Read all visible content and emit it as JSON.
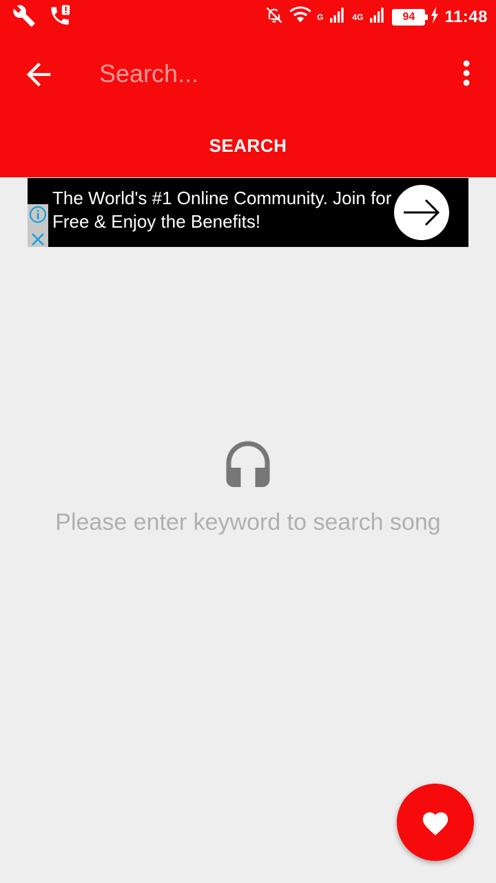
{
  "status_bar": {
    "battery": "94",
    "network_1": "G",
    "network_2": "4G",
    "time": "11:48"
  },
  "toolbar": {
    "search_placeholder": "Search..."
  },
  "tab": {
    "label": "SEARCH"
  },
  "ad": {
    "text": "The World's #1 Online Community. Join for Free & Enjoy the Benefits!"
  },
  "empty_state": {
    "message": "Please enter keyword to search song"
  },
  "colors": {
    "primary": "#f60a0b",
    "background": "#eeeeee",
    "empty_text": "#b0b0b0",
    "icon_gray": "#777777"
  }
}
